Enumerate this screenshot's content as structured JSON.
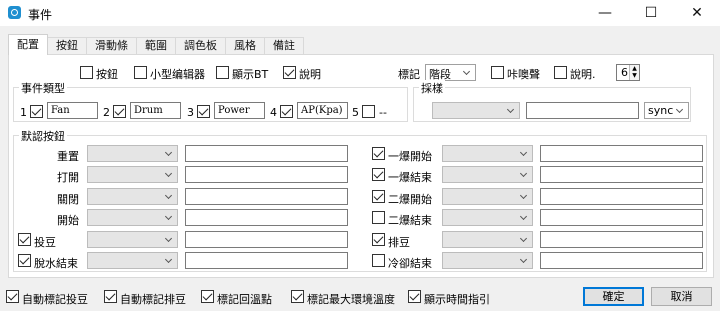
{
  "window": {
    "title": "事件",
    "app_icon": "app-logo-icon",
    "controls": {
      "minimize": "—",
      "maximize": "☐",
      "close": "✕"
    }
  },
  "tabs": [
    "配置",
    "按鈕",
    "滑動條",
    "範圍",
    "調色板",
    "風格",
    "備註"
  ],
  "top_options": {
    "button": {
      "label": "按鈕",
      "checked": false
    },
    "mini_editor": {
      "label": "小型编辑器",
      "checked": false
    },
    "show_bt": {
      "label": "顯示BT",
      "checked": false
    },
    "description": {
      "label": "說明",
      "checked": true
    },
    "marker_label": "標記",
    "marker_value": "階段",
    "beep": {
      "label": "咔噢聲",
      "checked": false
    },
    "desc2": {
      "label": "說明.",
      "checked": false
    },
    "count_value": "6"
  },
  "event_type": {
    "title": "事件類型",
    "items": [
      {
        "index": "1",
        "checked": true,
        "value": "Fan"
      },
      {
        "index": "2",
        "checked": true,
        "value": "Drum"
      },
      {
        "index": "3",
        "checked": true,
        "value": "Power"
      },
      {
        "index": "4",
        "checked": true,
        "value": "AP(Kpa)"
      },
      {
        "index": "5",
        "checked": false,
        "value": "--"
      }
    ]
  },
  "sampling": {
    "title": "採樣",
    "combo_value": "",
    "text_value": "",
    "sync_value": "sync"
  },
  "default_buttons": {
    "title": "默認按鈕",
    "left": [
      {
        "label": "重置",
        "checkbox": false,
        "checked": false
      },
      {
        "label": "打開",
        "checkbox": false,
        "checked": false
      },
      {
        "label": "關閉",
        "checkbox": false,
        "checked": false
      },
      {
        "label": "開始",
        "checkbox": false,
        "checked": false
      },
      {
        "label": "投豆",
        "checkbox": true,
        "checked": true
      },
      {
        "label": "脫水結束",
        "checkbox": true,
        "checked": true
      }
    ],
    "right": [
      {
        "label": "一爆開始",
        "checked": true
      },
      {
        "label": "一爆結束",
        "checked": true
      },
      {
        "label": "二爆開始",
        "checked": true
      },
      {
        "label": "二爆結束",
        "checked": false
      },
      {
        "label": "排豆",
        "checked": true
      },
      {
        "label": "冷卻結束",
        "checked": false
      }
    ]
  },
  "bottom_options": [
    {
      "label": "自動標記投豆",
      "checked": true
    },
    {
      "label": "自動標記排豆",
      "checked": true
    },
    {
      "label": "標記回溫點",
      "checked": true
    },
    {
      "label": "標記最大環境溫度",
      "checked": true
    },
    {
      "label": "顯示時間指引",
      "checked": true
    }
  ],
  "buttons": {
    "ok": "確定",
    "cancel": "取消"
  }
}
